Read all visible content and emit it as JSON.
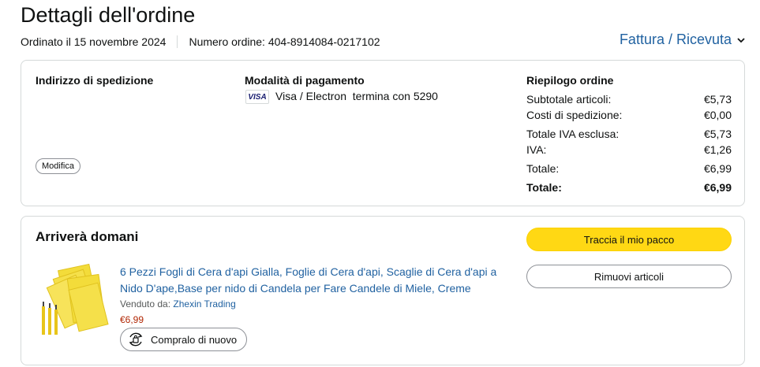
{
  "header": {
    "title": "Dettagli dell'ordine",
    "ordered_on": "Ordinato il 15 novembre 2024",
    "order_number": "Numero ordine: 404-8914084-0217102",
    "invoice_link": "Fattura / Ricevuta"
  },
  "shipping": {
    "label": "Indirizzo di spedizione",
    "modify_label": "Modifica"
  },
  "payment": {
    "label": "Modalità di pagamento",
    "card_brand": "VISA",
    "card_text": "Visa / Electron  termina con 5290"
  },
  "summary": {
    "label": "Riepilogo ordine",
    "rows": [
      {
        "label": "Subtotale articoli:",
        "value": "€5,73"
      },
      {
        "label": "Costi di spedizione:",
        "value": "€0,00"
      },
      {
        "label": "Totale IVA esclusa:",
        "value": "€5,73"
      },
      {
        "label": "IVA:",
        "value": "€1,26"
      },
      {
        "label": "Totale:",
        "value": "€6,99"
      },
      {
        "label": "Totale:",
        "value": "€6,99"
      }
    ]
  },
  "shipment": {
    "status": "Arriverà domani",
    "product_title": "6 Pezzi Fogli di Cera d'api Gialla, Foglie di Cera d'api, Scaglie di Cera d'api a Nido D'ape,Base per nido di Candela per Fare Candele di Miele, Creme",
    "sold_by_label": "Venduto da:",
    "seller": "Zhexin Trading",
    "price": "€6,99",
    "buy_again_label": "Compralo di nuovo",
    "track_label": "Traccia il mio pacco",
    "remove_label": "Rimuovi articoli"
  },
  "colors": {
    "link": "#2162a1",
    "price": "#b12704",
    "primary_button": "#ffd814",
    "border": "#d5d9d9"
  }
}
